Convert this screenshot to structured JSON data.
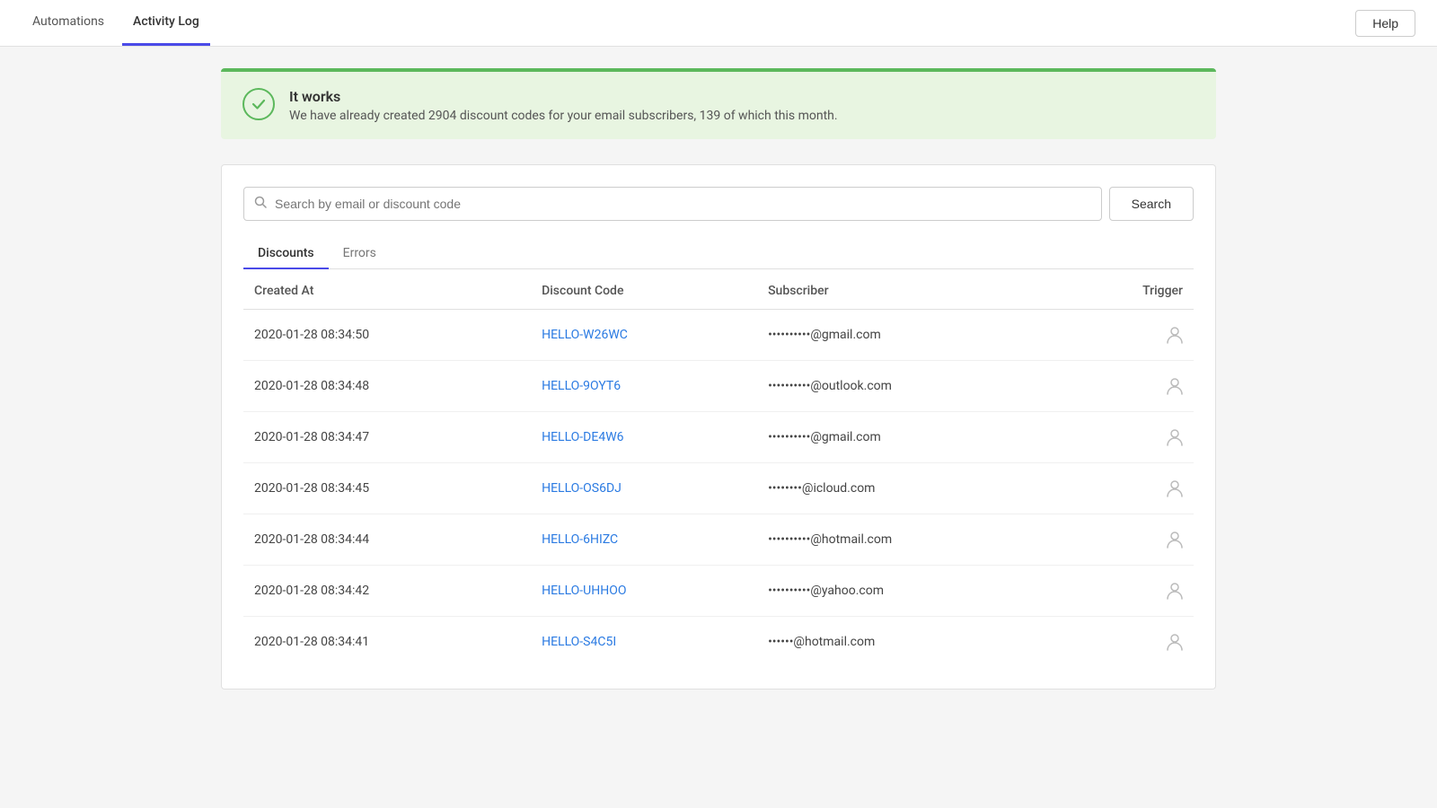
{
  "nav": {
    "tabs": [
      {
        "id": "automations",
        "label": "Automations",
        "active": false
      },
      {
        "id": "activity-log",
        "label": "Activity Log",
        "active": true
      }
    ],
    "help_button_label": "Help"
  },
  "banner": {
    "title": "It works",
    "description": "We have already created 2904 discount codes for your email subscribers, 139 of which this month."
  },
  "search": {
    "placeholder": "Search by email or discount code",
    "button_label": "Search",
    "current_value": ""
  },
  "inner_tabs": [
    {
      "id": "discounts",
      "label": "Discounts",
      "active": true
    },
    {
      "id": "errors",
      "label": "Errors",
      "active": false
    }
  ],
  "table": {
    "columns": [
      {
        "id": "created_at",
        "label": "Created At"
      },
      {
        "id": "discount_code",
        "label": "Discount Code"
      },
      {
        "id": "subscriber",
        "label": "Subscriber"
      },
      {
        "id": "trigger",
        "label": "Trigger"
      }
    ],
    "rows": [
      {
        "created_at": "2020-01-28 08:34:50",
        "discount_code": "HELLO-W26WC",
        "subscriber": "••••••••••@gmail.com",
        "trigger": "person"
      },
      {
        "created_at": "2020-01-28 08:34:48",
        "discount_code": "HELLO-9OYT6",
        "subscriber": "••••••••••@outlook.com",
        "trigger": "person"
      },
      {
        "created_at": "2020-01-28 08:34:47",
        "discount_code": "HELLO-DE4W6",
        "subscriber": "••••••••••@gmail.com",
        "trigger": "person"
      },
      {
        "created_at": "2020-01-28 08:34:45",
        "discount_code": "HELLO-OS6DJ",
        "subscriber": "••••••••@icloud.com",
        "trigger": "person"
      },
      {
        "created_at": "2020-01-28 08:34:44",
        "discount_code": "HELLO-6HIZC",
        "subscriber": "••••••••••@hotmail.com",
        "trigger": "person"
      },
      {
        "created_at": "2020-01-28 08:34:42",
        "discount_code": "HELLO-UHHOO",
        "subscriber": "••••••••••@yahoo.com",
        "trigger": "person"
      },
      {
        "created_at": "2020-01-28 08:34:41",
        "discount_code": "HELLO-S4C5I",
        "subscriber": "••••••@hotmail.com",
        "trigger": "person"
      }
    ]
  }
}
